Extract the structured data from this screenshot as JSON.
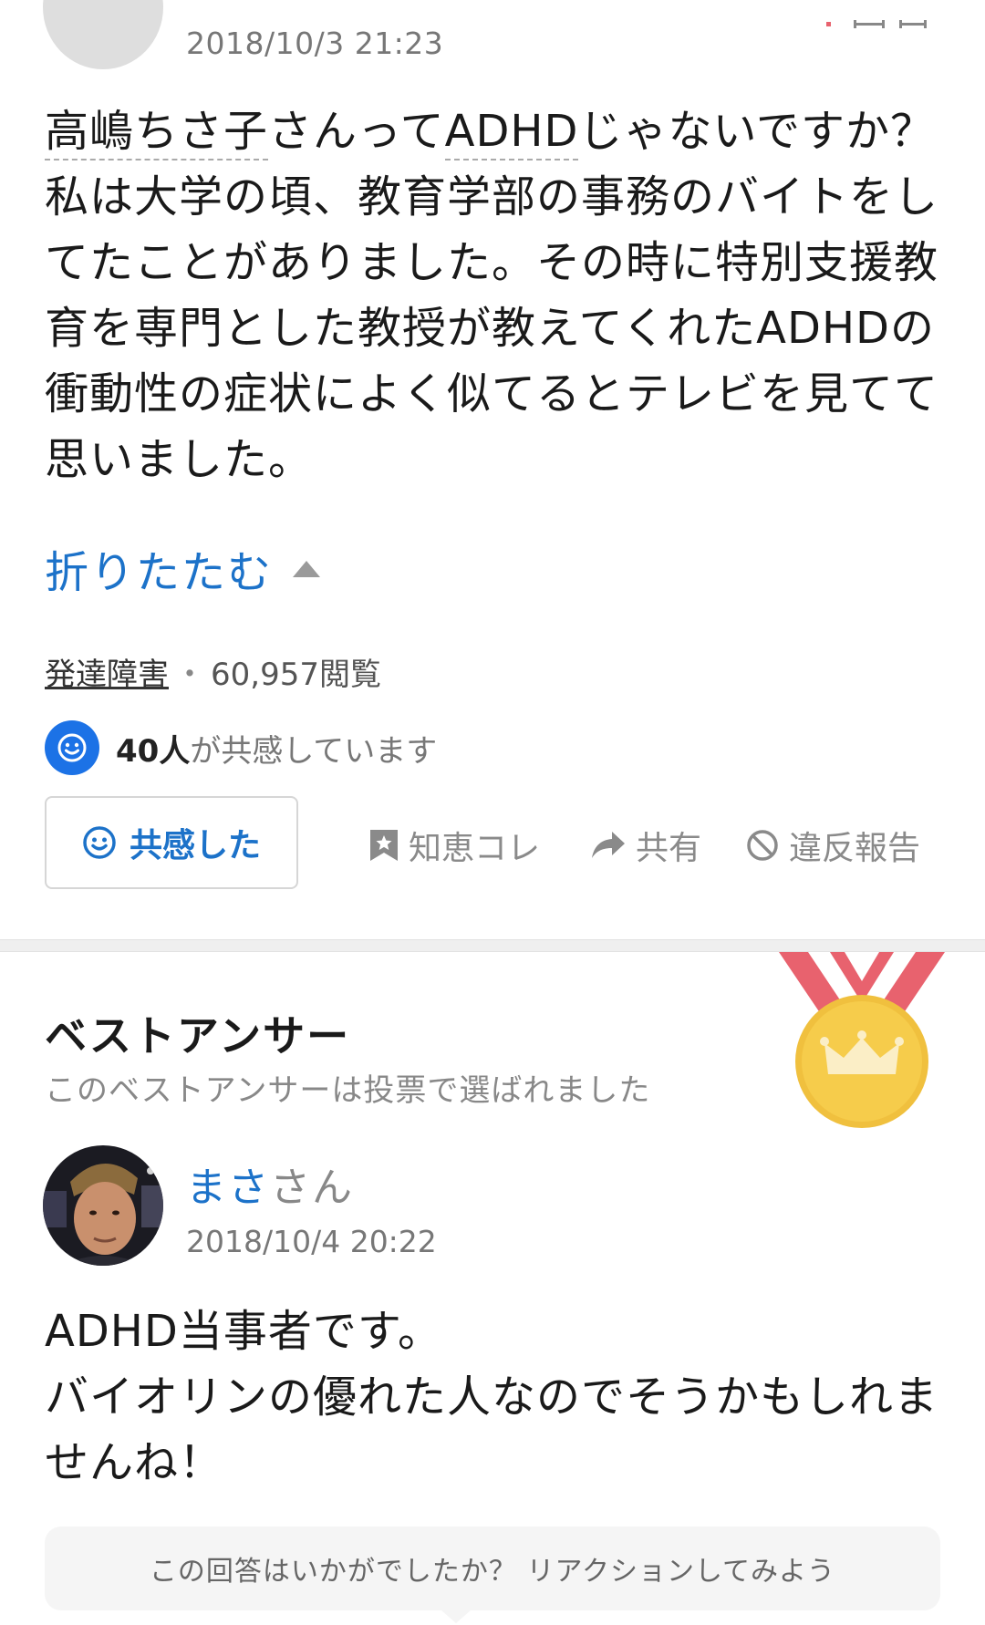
{
  "question": {
    "date": "2018/10/3 21:23",
    "keyword1": "高嶋ちさ子",
    "text_part1": "さんって",
    "keyword2": "ADHD",
    "text_part2": "じゃないですか？",
    "text_line2": "私は大学の頃、教育学部の事務のバイトをしてたことがありました。その時に特別支援教育を専門とした教授が教えてくれたADHDの衝動性の症状によく似てるとテレビを見てて思いました。",
    "collapse_label": "折りたたむ",
    "category": "発達障害",
    "separator": "・",
    "views": "60,957閲覧",
    "empathy_count": "40人",
    "empathy_suffix": "が共感しています",
    "empathy_button_label": "共感した",
    "actions": {
      "chie_label": "知恵コレ",
      "share_label": "共有",
      "report_label": "違反報告"
    }
  },
  "best_answer": {
    "title": "ベストアンサー",
    "subtitle": "このベストアンサーは投票で選ばれました",
    "user_name_link": "まさ",
    "user_name_suffix": "さん",
    "date": "2018/10/4 20:22",
    "line1": "ADHD当事者です。",
    "line2": "バイオリンの優れた人なのでそうかもしれませんね！",
    "reaction_prompt": "この回答はいかがでしたか？ リアクションしてみよう"
  },
  "colors": {
    "link_blue": "#1c72c9",
    "empathy_blue": "#1c72e6",
    "medal_gold": "#f6cc4b",
    "ribbon_red": "#e8626e"
  },
  "icons": [
    "smile-icon",
    "bookmark-star-icon",
    "share-arrow-icon",
    "prohibit-icon",
    "crown-icon",
    "medal-icon",
    "collapse-triangle-icon"
  ]
}
